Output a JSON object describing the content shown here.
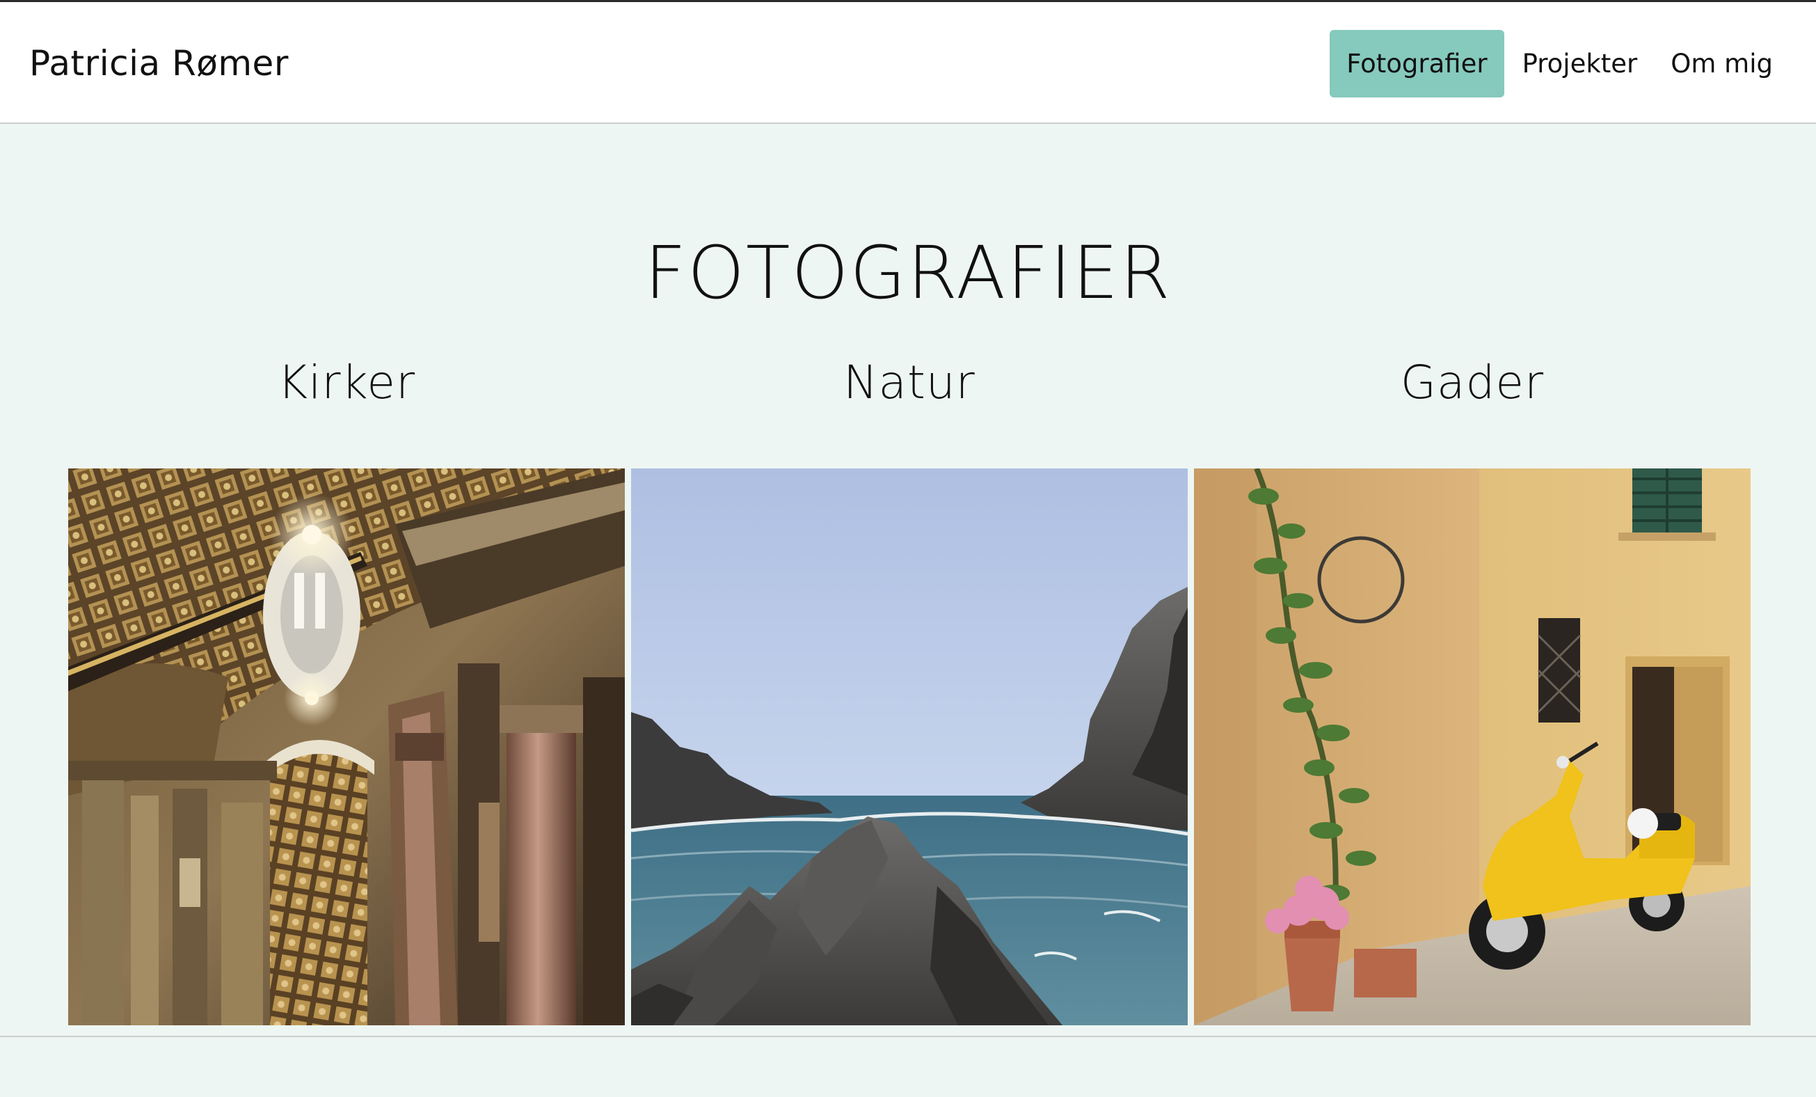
{
  "header": {
    "brand": "Patricia Rømer",
    "nav": [
      {
        "label": "Fotografier",
        "active": true
      },
      {
        "label": "Projekter",
        "active": false
      },
      {
        "label": "Om mig",
        "active": false
      }
    ]
  },
  "main": {
    "title": "FOTOGRAFIER",
    "categories": [
      {
        "label": "Kirker",
        "image": "church-interior-photo"
      },
      {
        "label": "Natur",
        "image": "rocky-coast-photo"
      },
      {
        "label": "Gader",
        "image": "street-scooter-photo"
      }
    ]
  },
  "colors": {
    "background": "#eef6f3",
    "accent": "#86c9bd",
    "header_bg": "#ffffff"
  }
}
